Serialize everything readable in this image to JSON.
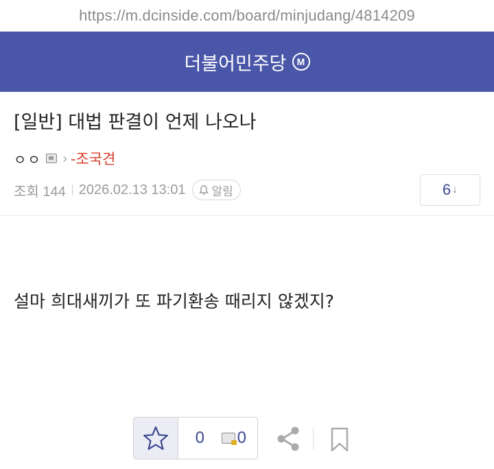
{
  "browser": {
    "url": "https://m.dcinside.com/board/minjudang/4814209"
  },
  "header": {
    "gallery_name": "더불어민주당",
    "minor_badge": "M"
  },
  "post": {
    "title": "[일반] 대법 판결이 언제 나오나",
    "author_nick": "ㅇㅇ",
    "author_flair": "-조국견",
    "views": "조회 144",
    "datetime": "2026.02.13 13:01",
    "alarm_label": "알림",
    "comment_count": "6",
    "comment_arrow": "↓",
    "body": "설마 희대새끼가 또 파기환송 때리지 않겠지?"
  },
  "actions": {
    "recommend_count": "0",
    "fixed_recommend_count": "0",
    "icons": [
      "star-icon",
      "gonick-fix-icon",
      "share-icon",
      "bookmark-icon"
    ]
  },
  "colors": {
    "header_bg": "#4a56a8",
    "accent_text": "#3b4890",
    "flair_red": "#d8402b"
  }
}
